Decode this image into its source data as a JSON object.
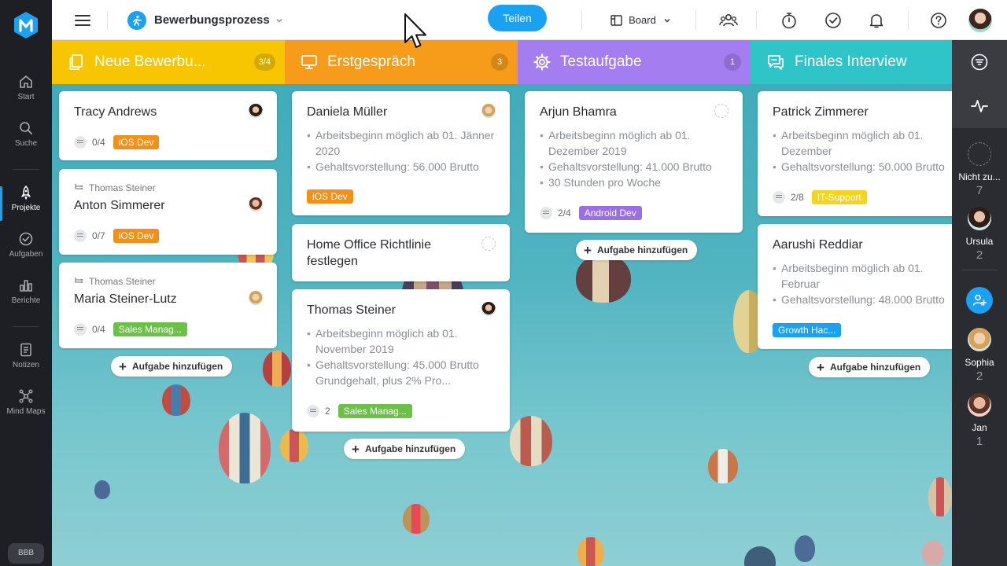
{
  "app": {
    "name": "MeisterTask",
    "user_initials": "BBB"
  },
  "nav": {
    "items": [
      {
        "label": "Start",
        "icon": "home-icon"
      },
      {
        "label": "Suche",
        "icon": "search-icon"
      },
      {
        "label": "Projekte",
        "icon": "rocket-icon",
        "active": true
      },
      {
        "label": "Aufgaben",
        "icon": "check-circle-icon"
      },
      {
        "label": "Berichte",
        "icon": "bar-chart-icon"
      },
      {
        "label": "Notizen",
        "icon": "note-icon"
      },
      {
        "label": "Mind Maps",
        "icon": "mindmap-icon"
      }
    ]
  },
  "topbar": {
    "project_title": "Bewerbungsprozess",
    "share_label": "Teilen",
    "view_label": "Board"
  },
  "columns": [
    {
      "title": "Neue Bewerbu...",
      "count": "3/4",
      "color": "#f7c600",
      "icon": "documents-icon",
      "add_label": "Aufgabe hinzufügen",
      "cards": [
        {
          "title": "Tracy Andrews",
          "checklist": "0/4",
          "tag": "iOS Dev",
          "tag_color": "#f39019"
        },
        {
          "parent": "Thomas Steiner",
          "title": "Anton Simmerer",
          "checklist": "0/7",
          "tag": "iOS Dev",
          "tag_color": "#f39019"
        },
        {
          "parent": "Thomas Steiner",
          "title": "Maria Steiner-Lutz",
          "checklist": "0/4",
          "tag": "Sales Manag...",
          "tag_color": "#6cc04a"
        }
      ]
    },
    {
      "title": "Erstgespräch",
      "count": "3",
      "color": "#f79b1b",
      "icon": "monitor-icon",
      "add_label": "Aufgabe hinzufügen",
      "cards": [
        {
          "title": "Daniela Müller",
          "bullets": [
            "Arbeitsbeginn möglich ab 01. Jänner 2020",
            "Gehaltsvorstellung: 56.000 Brutto"
          ],
          "tag": "iOS Dev",
          "tag_color": "#f39019"
        },
        {
          "title": "Home Office Richtlinie festlegen"
        },
        {
          "title": "Thomas Steiner",
          "bullets": [
            "Arbeitsbeginn möglich ab 01. November 2019",
            "Gehaltsvorstellung: 45.000 Brutto Grundgehalt, plus 2% Pro..."
          ],
          "subtasks": "2",
          "tag": "Sales Manag...",
          "tag_color": "#6cc04a"
        }
      ]
    },
    {
      "title": "Testaufgabe",
      "count": "1",
      "color": "#a47ef0",
      "icon": "gear-icon",
      "add_label": "Aufgabe hinzufügen",
      "cards": [
        {
          "title": "Arjun Bhamra",
          "bullets": [
            "Arbeitsbeginn möglich ab 01. Dezember 2019",
            "Gehaltsvorstellung: 41.000 Brutto",
            "30 Stunden pro Woche"
          ],
          "checklist": "2/4",
          "tag": "Android Dev",
          "tag_color": "#9a6fe6"
        }
      ]
    },
    {
      "title": "Finales Interview",
      "count": "",
      "color": "#2fc4c8",
      "icon": "chat-icon",
      "add_label": "Aufgabe hinzufügen",
      "cards": [
        {
          "title": "Patrick Zimmerer",
          "bullets": [
            "Arbeitsbeginn möglich ab 01. Dezember",
            "Gehaltsvorstellung: 50.000 Brutto"
          ],
          "checklist": "2/8",
          "tag": "IT-Support",
          "tag_color": "#f5d41c"
        },
        {
          "title": "Aarushi Reddiar",
          "bullets": [
            "Arbeitsbeginn möglich ab 01. Februar",
            "Gehaltsvorstellung: 48.000 Brutto"
          ],
          "tag": "Growth Hac...",
          "tag_color": "#1aa1f2"
        }
      ]
    }
  ],
  "right_panel": {
    "users": [
      {
        "name": "Nicht zu...",
        "count": "7"
      },
      {
        "name": "Ursula",
        "count": "2"
      },
      {
        "name": "Sophia",
        "count": "2"
      },
      {
        "name": "Jan",
        "count": "1"
      }
    ]
  }
}
